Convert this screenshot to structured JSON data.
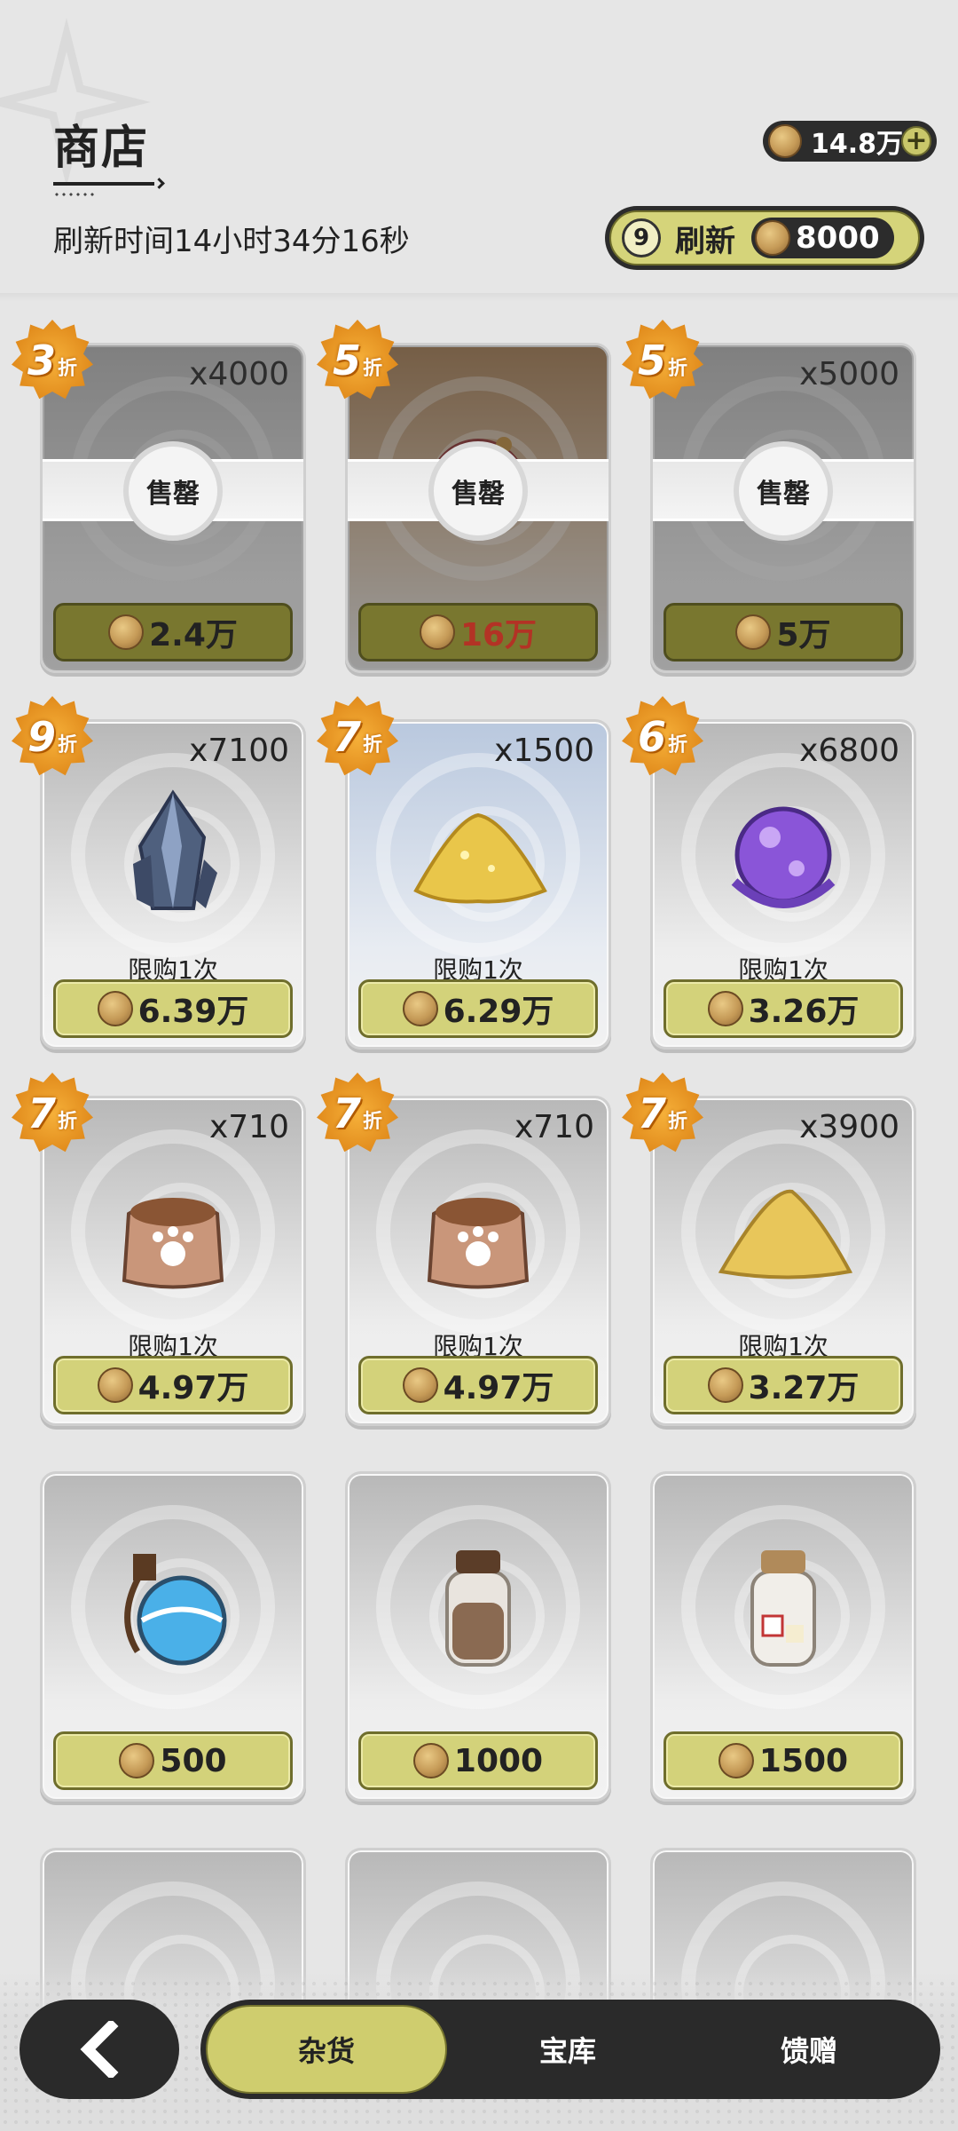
{
  "header": {
    "title": "商店",
    "currency_amount": "14.8万",
    "timer": "刷新时间14小时34分16秒",
    "refresh": {
      "count": "9",
      "label": "刷新",
      "price": "8000"
    }
  },
  "shop": {
    "sold_label": "售罄",
    "limit_label": "限购1次",
    "discount_unit": "折",
    "items": [
      {
        "discount": "3",
        "qty": "x4000",
        "price": "2.4万",
        "sold": true,
        "art": "bag-brown"
      },
      {
        "discount": "5",
        "qty": "",
        "price": "16万",
        "price_color": "#b33225",
        "sold": true,
        "art": "pouch-red"
      },
      {
        "discount": "5",
        "qty": "x5000",
        "price": "5万",
        "sold": true,
        "art": "bag-brown"
      },
      {
        "discount": "9",
        "qty": "x7100",
        "price": "6.39万",
        "limited": true,
        "art": "crystal"
      },
      {
        "discount": "7",
        "qty": "x1500",
        "price": "6.29万",
        "limited": true,
        "art": "gold-pile"
      },
      {
        "discount": "6",
        "qty": "x6800",
        "price": "3.26万",
        "limited": true,
        "art": "purple-orb"
      },
      {
        "discount": "7",
        "qty": "x710",
        "price": "4.97万",
        "limited": true,
        "art": "paw-sack"
      },
      {
        "discount": "7",
        "qty": "x710",
        "price": "4.97万",
        "limited": true,
        "art": "paw-sack"
      },
      {
        "discount": "7",
        "qty": "x3900",
        "price": "3.27万",
        "limited": true,
        "art": "sand-pile"
      },
      {
        "discount": "",
        "qty": "",
        "price": "500",
        "art": "blue-flask"
      },
      {
        "discount": "",
        "qty": "",
        "price": "1000",
        "art": "brown-jar"
      },
      {
        "discount": "",
        "qty": "",
        "price": "1500",
        "art": "white-jar"
      },
      {
        "discount": "",
        "qty": "",
        "price": "",
        "art": "jar-partial"
      },
      {
        "discount": "",
        "qty": "",
        "price": "",
        "art": "yellow-partial"
      },
      {
        "discount": "",
        "qty": "",
        "price": "",
        "art": "blue-partial"
      }
    ]
  },
  "tabs": [
    {
      "label": "杂货",
      "active": true
    },
    {
      "label": "宝库",
      "active": false
    },
    {
      "label": "馈赠",
      "active": false
    }
  ],
  "colors": {
    "accent": "#cfcd6e",
    "dark": "#2a2a2a",
    "discount": "#e8951f",
    "price_red": "#b33225"
  },
  "icons": {
    "currency": "gold-coin-icon",
    "back": "chevron-left-icon",
    "refresh": "refresh-cycle-icon",
    "add": "plus-icon"
  }
}
